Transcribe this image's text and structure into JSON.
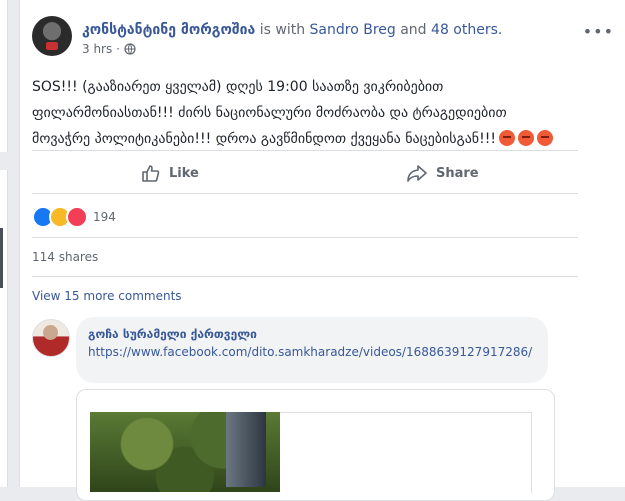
{
  "post": {
    "author": "კონსტანტინე მორგოშია",
    "with_text": " is with ",
    "tagged": "Sandro Breg",
    "and_text": " and ",
    "others": "48 others.",
    "time": "3 hrs",
    "time_separator": "·",
    "more_glyph": "•••",
    "text_line1": "SOS!!! (გააზიარეთ ყველამ) დღეს 19:00 საათზე ვიკრიბებით",
    "text_line2": "ფილარმონიასთან!!! ძირს ნაციონალური მოძრაობა და ტრაგედიებით",
    "text_line3": "მოვაჭრე პოლიტიკანები!!! დროა გავწმინდოთ ქვეყანა ნაცებისგან!!!"
  },
  "actions": {
    "like": "Like",
    "share": "Share"
  },
  "reactions": {
    "count": "194",
    "types": [
      "like-icon",
      "haha-icon",
      "love-icon"
    ]
  },
  "shares": "114 shares",
  "more_comments": "View 15 more comments",
  "comment": {
    "author": "გოჩა სურამელი ქართველი",
    "text": "https://www.facebook.com/dito.samkharadze/videos/1688639127917286/"
  },
  "colors": {
    "link": "#385898",
    "background": "#e9ebee",
    "muted": "#606770"
  }
}
